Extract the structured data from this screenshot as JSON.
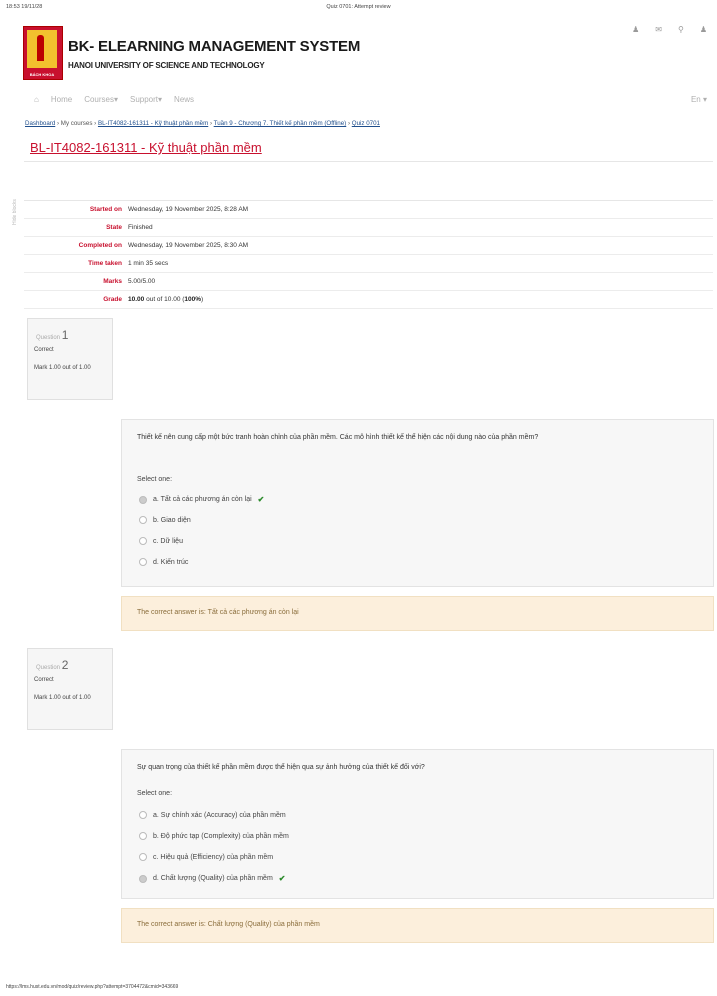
{
  "print_header": {
    "datetime": "18:53 19/11/28",
    "page_title": "Quiz 0701: Attempt review"
  },
  "branding": {
    "logo_caption": "BÁCH KHOA",
    "title": "BK- ELEARNING MANAGEMENT SYSTEM",
    "subtitle": "HANOI UNIVERSITY OF SCIENCE AND TECHNOLOGY"
  },
  "top_icons": [
    "user-icon",
    "chat-icon",
    "search-icon",
    "user-icon"
  ],
  "nav": {
    "home": "Home",
    "courses": "Courses",
    "support": "Support",
    "news": "News",
    "language": "En"
  },
  "breadcrumb": [
    "Dashboard",
    "My courses",
    "BL-IT4082-161311 - Kỹ thuật phần mềm",
    "Tuần 9 - Chương 7. Thiết kế phần mềm (Offline)",
    "Quiz 0701"
  ],
  "course_title": "BL-IT4082-161311 - Kỹ thuật phần mềm",
  "hide_blocks": "Hide blocks",
  "summary": [
    {
      "label": "Started on",
      "value": "Wednesday, 19 November 2025, 8:28 AM"
    },
    {
      "label": "State",
      "value": "Finished"
    },
    {
      "label": "Completed on",
      "value": "Wednesday, 19 November 2025, 8:30 AM"
    },
    {
      "label": "Time taken",
      "value": "1 min 35 secs"
    },
    {
      "label": "Marks",
      "value": "5.00/5.00"
    }
  ],
  "grade": {
    "label": "Grade",
    "score": "10.00",
    "text": "out of 10.00 (",
    "percent": "100%",
    "close": ")"
  },
  "questions": [
    {
      "label": "Question",
      "number": "1",
      "status": "Correct",
      "mark": "Mark 1.00 out of 1.00",
      "text": "Thiết kế nên cung cấp một bức tranh hoàn chỉnh của phần mềm. Các mô hình thiết kế thể hiện các nội dung nào của phần mềm?",
      "select_label": "Select one:",
      "options": [
        "a. Tất cả các phương án còn lại",
        "b. Giao diện",
        "c. Dữ liệu",
        "d. Kiến trúc"
      ],
      "correct_answer": "The correct answer is: Tất cả các phương án còn lại"
    },
    {
      "label": "Question",
      "number": "2",
      "status": "Correct",
      "mark": "Mark 1.00 out of 1.00",
      "text": "Sự quan trọng của thiết kế phần mềm được thể hiện qua sự ảnh hưởng của thiết kế đối với?",
      "select_label": "Select one:",
      "options": [
        "a. Sự chính xác (Accuracy) của phần mềm",
        "b. Độ phức tạp (Complexity) của phần mềm",
        "c. Hiệu quả (Efficiency) của phần mềm",
        "d. Chất lượng (Quality) của phần mềm"
      ],
      "correct_answer": "The correct answer is: Chất lượng (Quality) của phần mềm"
    }
  ],
  "footer_url": "https://lms.hust.edu.vn/mod/quiz/review.php?attempt=3704472&cmid=343669",
  "colors": {
    "brand": "#c8102e",
    "feedback_bg": "#fcefdc",
    "correct_tick": "#2a8a2a"
  }
}
